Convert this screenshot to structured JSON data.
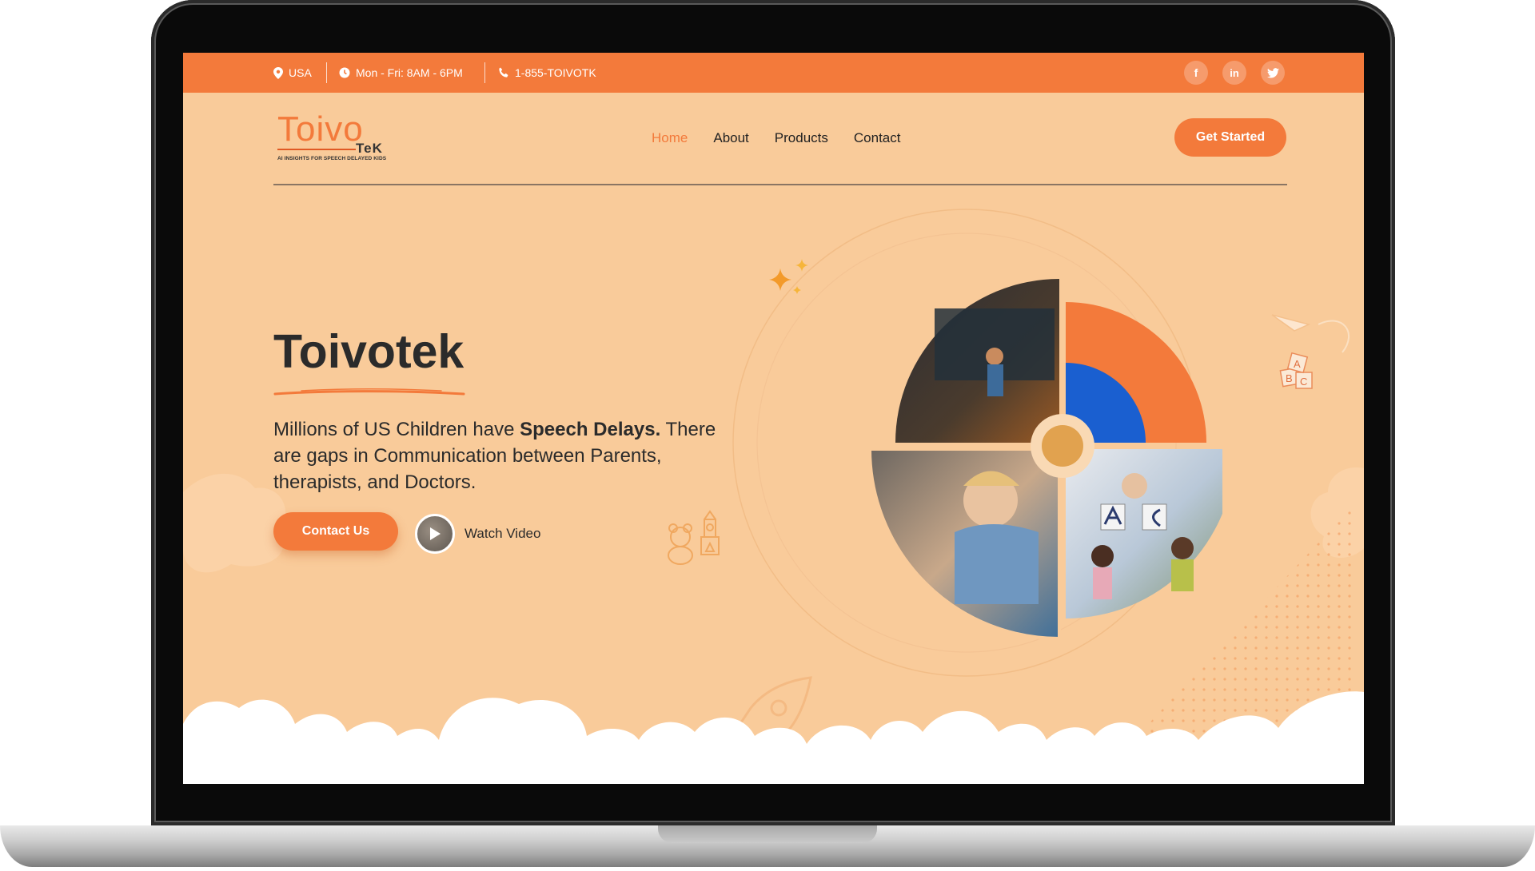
{
  "topbar": {
    "location": "USA",
    "hours": "Mon - Fri: 8AM - 6PM",
    "phone": "1-855-TOIVOTK",
    "social": [
      {
        "icon": "facebook-icon",
        "label": "f"
      },
      {
        "icon": "linkedin-icon",
        "label": "in"
      },
      {
        "icon": "twitter-icon",
        "label": "t"
      }
    ]
  },
  "logo": {
    "word": "Toivo",
    "sub": "TeK",
    "tagline": "AI INSIGHTS FOR SPEECH DELAYED KIDS"
  },
  "nav": {
    "items": [
      {
        "label": "Home",
        "active": true
      },
      {
        "label": "About",
        "active": false
      },
      {
        "label": "Products",
        "active": false
      },
      {
        "label": "Contact",
        "active": false
      }
    ],
    "cta": "Get Started"
  },
  "hero": {
    "title": "Toivotek",
    "text_1": "Millions of US Children have ",
    "text_bold": "Speech Delays.",
    "text_2": " There are gaps in Communication between Parents, therapists, and Doctors.",
    "contact_button": "Contact Us",
    "watch_label": "Watch Video"
  },
  "colors": {
    "brand_orange": "#f37a3b",
    "hero_background": "#f9cb9a",
    "accent_blue": "#1a5fd0",
    "text_dark": "#2b2b2b"
  }
}
